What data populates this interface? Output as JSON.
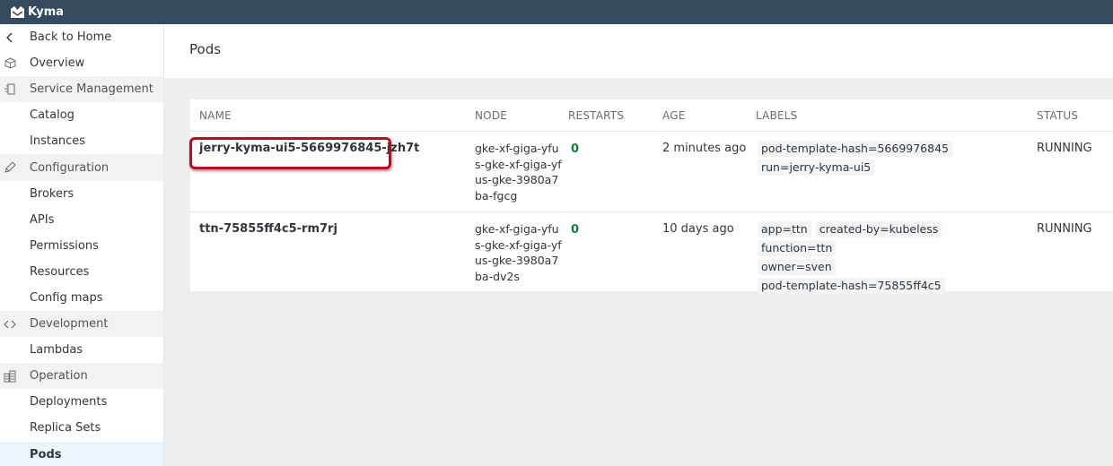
{
  "app": {
    "title": "Kyma"
  },
  "sidebar": {
    "items": [
      {
        "label": "Back to Home",
        "icon": "chevron-left-icon",
        "kind": "link"
      },
      {
        "label": "Overview",
        "icon": "cube-icon",
        "kind": "link"
      },
      {
        "label": "Service Management",
        "icon": "service-icon",
        "kind": "section"
      },
      {
        "label": "Catalog",
        "kind": "link"
      },
      {
        "label": "Instances",
        "kind": "link"
      },
      {
        "label": "Configuration",
        "icon": "edit-icon",
        "kind": "section"
      },
      {
        "label": "Brokers",
        "kind": "link"
      },
      {
        "label": "APIs",
        "kind": "link"
      },
      {
        "label": "Permissions",
        "kind": "link"
      },
      {
        "label": "Resources",
        "kind": "link"
      },
      {
        "label": "Config maps",
        "kind": "link"
      },
      {
        "label": "Development",
        "icon": "code-icon",
        "kind": "section"
      },
      {
        "label": "Lambdas",
        "kind": "link"
      },
      {
        "label": "Operation",
        "icon": "operation-icon",
        "kind": "section"
      },
      {
        "label": "Deployments",
        "kind": "link"
      },
      {
        "label": "Replica Sets",
        "kind": "link"
      },
      {
        "label": "Pods",
        "kind": "link",
        "active": true
      }
    ]
  },
  "page": {
    "title": "Pods"
  },
  "table": {
    "columns": [
      "NAME",
      "NODE",
      "RESTARTS",
      "AGE",
      "LABELS",
      "STATUS"
    ],
    "rows": [
      {
        "name": "jerry-kyma-ui5-5669976845-jzh7t",
        "node": "gke-xf-giga-yfus-gke-xf-giga-yfus-gke-3980a7ba-fgcg",
        "restarts": "0",
        "age": "2 minutes ago",
        "labels": [
          "pod-template-hash=5669976845",
          "run=jerry-kyma-ui5"
        ],
        "status": "RUNNING"
      },
      {
        "name": "ttn-75855ff4c5-rm7rj",
        "node": "gke-xf-giga-yfus-gke-xf-giga-yfus-gke-3980a7ba-dv2s",
        "restarts": "0",
        "age": "10 days ago",
        "labels": [
          "app=ttn",
          "created-by=kubeless",
          "function=ttn",
          "owner=sven",
          "pod-template-hash=75855ff4c5"
        ],
        "status": "RUNNING"
      }
    ]
  },
  "colors": {
    "topbar": "#354a5f",
    "restarts_ok": "#107e3e",
    "highlight": "#d0021b"
  }
}
